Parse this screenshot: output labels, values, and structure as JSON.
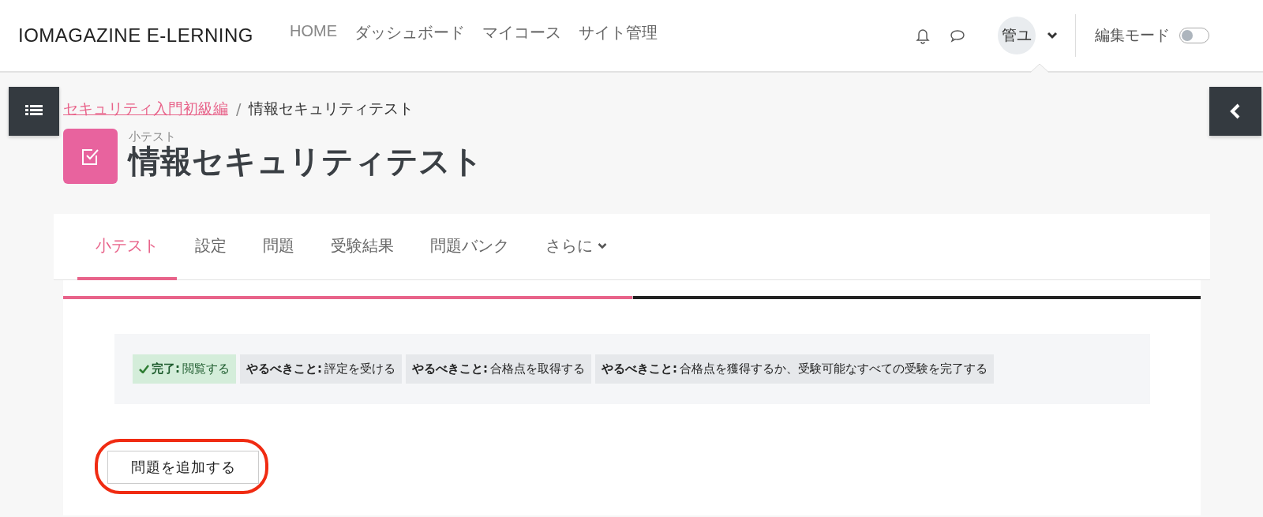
{
  "navbar": {
    "brand": "IOMAGAZINE E-LERNING",
    "links": [
      "HOME",
      "ダッシュボード",
      "マイコース",
      "サイト管理"
    ],
    "user_initials": "管ユ",
    "edit_mode": {
      "label": "編集モード",
      "on": false
    }
  },
  "breadcrumb": {
    "separator": "/",
    "items": [
      {
        "label": "セキュリティ入門初級編",
        "link": true
      },
      {
        "label": "情報セキュリティテスト",
        "link": false
      }
    ]
  },
  "header": {
    "kind_label": "小テスト",
    "title": "情報セキュリティテスト"
  },
  "tabs": [
    {
      "label": "小テスト",
      "selected": true,
      "dropdown": false
    },
    {
      "label": "設定",
      "selected": false,
      "dropdown": false
    },
    {
      "label": "問題",
      "selected": false,
      "dropdown": false
    },
    {
      "label": "受験結果",
      "selected": false,
      "dropdown": false
    },
    {
      "label": "問題バンク",
      "selected": false,
      "dropdown": false
    },
    {
      "label": "さらに",
      "selected": false,
      "dropdown": true
    }
  ],
  "progress": {
    "level": 0.5
  },
  "completion": [
    {
      "done": true,
      "label": "完了:",
      "text": "閲覧する"
    },
    {
      "done": false,
      "label": "やるべきこと:",
      "text": "評定を受ける"
    },
    {
      "done": false,
      "label": "やるべきこと:",
      "text": "合格点を取得する"
    },
    {
      "done": false,
      "label": "やるべきこと:",
      "text": "合格点を獲得するか、受験可能なすべての受験を完了する"
    }
  ],
  "action_button": {
    "label": "問題を追加する",
    "highlighted": true
  }
}
